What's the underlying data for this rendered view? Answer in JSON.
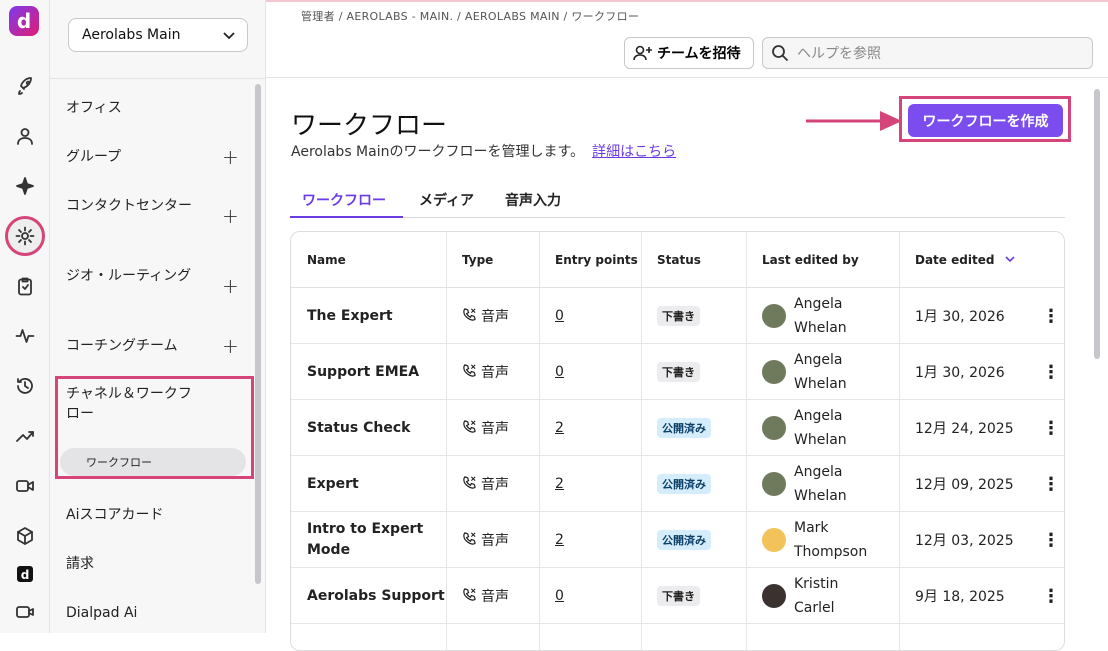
{
  "app": {
    "logo_letter": "d",
    "brand_color": "#7c4dee",
    "highlight_color": "#d6457a"
  },
  "rail": {
    "icons": [
      "rocket-icon",
      "person-icon",
      "sparkle-icon",
      "gear-icon",
      "clipboard-icon",
      "pulse-icon",
      "history-icon",
      "trending-icon",
      "video-camera-icon",
      "cube-icon",
      "dialpad-icon",
      "camera-icon"
    ]
  },
  "org_selector": {
    "value": "Aerolabs Main"
  },
  "nav": {
    "items": [
      {
        "label": "オフィス"
      },
      {
        "label": "グループ",
        "plus": "+"
      },
      {
        "label": "コンタクトセンター",
        "plus": "+"
      },
      {
        "label": "ジオ・ルーティング",
        "plus": "+"
      },
      {
        "label": "コーチングチーム",
        "plus": "+"
      },
      {
        "label": "チャネル＆ワークフロー"
      },
      {
        "label": "Aiスコアカード"
      },
      {
        "label": "請求"
      },
      {
        "label": "Dialpad Ai"
      }
    ],
    "sub_item": "ワークフロー"
  },
  "header": {
    "breadcrumb": "管理者 / AEROLABS - MAIN. / AEROLABS MAIN / ワークフロー",
    "invite_label": "チームを招待",
    "search_placeholder": "ヘルプを参照"
  },
  "page": {
    "title": "ワークフロー",
    "subtitle": "Aerolabs Mainのワークフローを管理します。",
    "learn_more": "詳細はこちら",
    "create_button": "ワークフローを作成"
  },
  "tabs": [
    "ワークフロー",
    "メディア",
    "音声入力"
  ],
  "table": {
    "columns": [
      "Name",
      "Type",
      "Entry points",
      "Status",
      "Last edited by",
      "Date edited"
    ],
    "sort_icon": "chevron-down-icon",
    "rows": [
      {
        "name": "The Expert",
        "type": "音声",
        "entry": "0",
        "status": "下書き",
        "status_kind": "draft",
        "user": "Angela Whelan",
        "avatar": "#6d7a5c",
        "date": "1月 30, 2026"
      },
      {
        "name": "Support EMEA",
        "type": "音声",
        "entry": "0",
        "status": "下書き",
        "status_kind": "draft",
        "user": "Angela Whelan",
        "avatar": "#6d7a5c",
        "date": "1月 30, 2026"
      },
      {
        "name": "Status Check",
        "type": "音声",
        "entry": "2",
        "status": "公開済み",
        "status_kind": "pub",
        "user": "Angela Whelan",
        "avatar": "#6d7a5c",
        "date": "12月 24, 2025"
      },
      {
        "name": "Expert",
        "type": "音声",
        "entry": "2",
        "status": "公開済み",
        "status_kind": "pub",
        "user": "Angela Whelan",
        "avatar": "#6d7a5c",
        "date": "12月 09, 2025"
      },
      {
        "name": "Intro to Expert Mode",
        "type": "音声",
        "entry": "2",
        "status": "公開済み",
        "status_kind": "pub",
        "user": "Mark Thompson",
        "avatar": "#f2c25b",
        "date": "12月 03, 2025"
      },
      {
        "name": "Aerolabs Support",
        "type": "音声",
        "entry": "0",
        "status": "下書き",
        "status_kind": "draft",
        "user": "Kristin Carlel",
        "avatar": "#3b3230",
        "date": "9月 18, 2025"
      }
    ]
  }
}
